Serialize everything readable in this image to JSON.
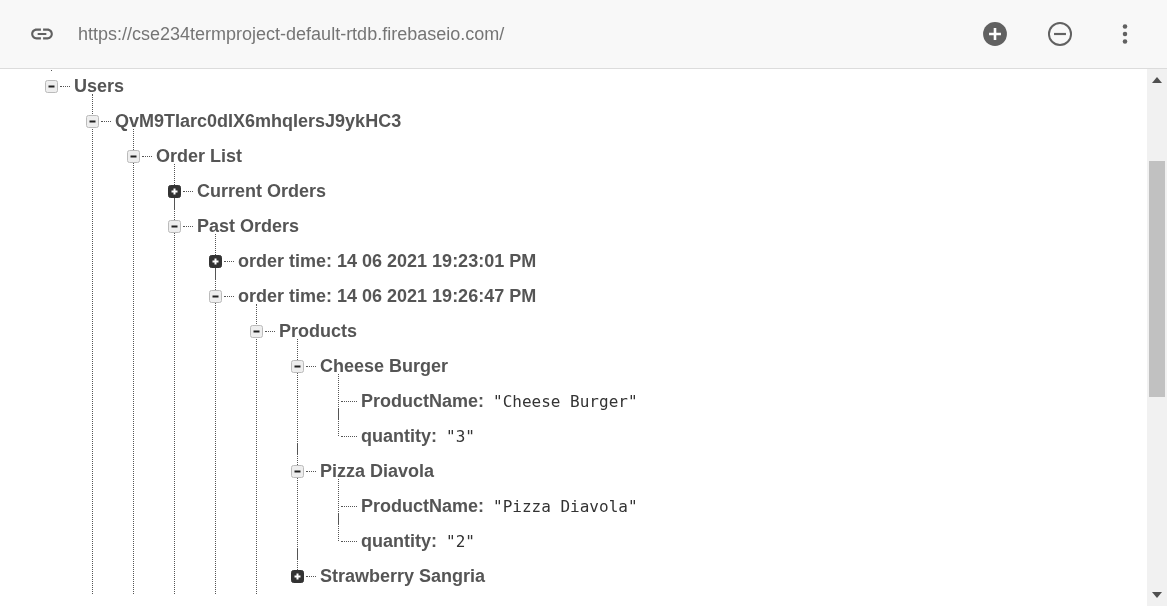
{
  "url": "https://cse234termproject-default-rtdb.firebaseio.com/",
  "tree": [
    {
      "key": "Users",
      "expanded": true,
      "children": [
        {
          "key": "QvM9TIarc0dIX6mhqIersJ9ykHC3",
          "expanded": true,
          "children": [
            {
              "key": "Order List",
              "expanded": true,
              "children": [
                {
                  "key": "Current Orders",
                  "expanded": false
                },
                {
                  "key": "Past Orders",
                  "expanded": true,
                  "children": [
                    {
                      "key": "order time: 14 06 2021 19:23:01 PM",
                      "expanded": false
                    },
                    {
                      "key": "order time: 14 06 2021 19:26:47 PM",
                      "expanded": true,
                      "children": [
                        {
                          "key": "Products",
                          "expanded": true,
                          "children": [
                            {
                              "key": "Cheese Burger",
                              "expanded": true,
                              "children": [
                                {
                                  "key": "ProductName:",
                                  "value": "\"Cheese Burger\""
                                },
                                {
                                  "key": "quantity:",
                                  "value": "\"3\""
                                }
                              ]
                            },
                            {
                              "key": "Pizza Diavola",
                              "expanded": true,
                              "children": [
                                {
                                  "key": "ProductName:",
                                  "value": "\"Pizza Diavola\""
                                },
                                {
                                  "key": "quantity:",
                                  "value": "\"2\""
                                }
                              ]
                            },
                            {
                              "key": "Strawberry Sangria",
                              "expanded": false
                            }
                          ]
                        }
                      ]
                    }
                  ]
                }
              ]
            }
          ]
        }
      ]
    }
  ]
}
